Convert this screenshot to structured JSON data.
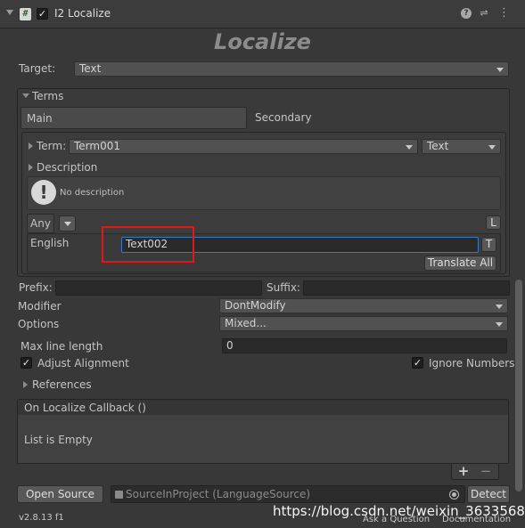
{
  "header": {
    "component_title": "I2 Localize",
    "script_icon": "#",
    "enabled_check": "✓",
    "icons": [
      "help-icon",
      "presets-icon",
      "context-menu-icon"
    ]
  },
  "title": "Localize",
  "target": {
    "label": "Target:",
    "value": "Text"
  },
  "terms": {
    "section_label": "Terms",
    "tabs": [
      "Main",
      "Secondary"
    ],
    "term_label": "Term:",
    "term_value": "Term001",
    "term_type": "Text",
    "description_label": "Description",
    "description_text": "No description",
    "filter_value": "Any",
    "lang_toggle": "L",
    "language": "English",
    "translation_value": "Text002",
    "t_button": "T",
    "translate_all_button": "Translate All"
  },
  "prefix_label": "Prefix:",
  "suffix_label": "Suffix:",
  "modifier": {
    "label": "Modifier",
    "value": "DontModify"
  },
  "options": {
    "label": "Options",
    "value": "Mixed..."
  },
  "max_line_length": {
    "label": "Max line length",
    "value": "0"
  },
  "adjust_alignment": {
    "label": "Adjust Alignment",
    "checked": "✓"
  },
  "ignore_numbers": {
    "label": "Ignore Numbers",
    "checked": "✓"
  },
  "references_label": "References",
  "callback": {
    "header": "On Localize Callback ()",
    "empty_text": "List is Empty",
    "add": "+",
    "remove": "−"
  },
  "source": {
    "open_button": "Open Source",
    "field_value": "SourceInProject (LanguageSource)",
    "detect_button": "Detect"
  },
  "footer": {
    "version": "v2.8.13 f1",
    "ask_link": "Ask a Question",
    "docs_link": "Documentation"
  },
  "watermark": "https://blog.csdn.net/weixin_36335685",
  "colors": {
    "highlight": "#e0181a",
    "focus_border": "#3a79bb",
    "background": "#383838"
  }
}
